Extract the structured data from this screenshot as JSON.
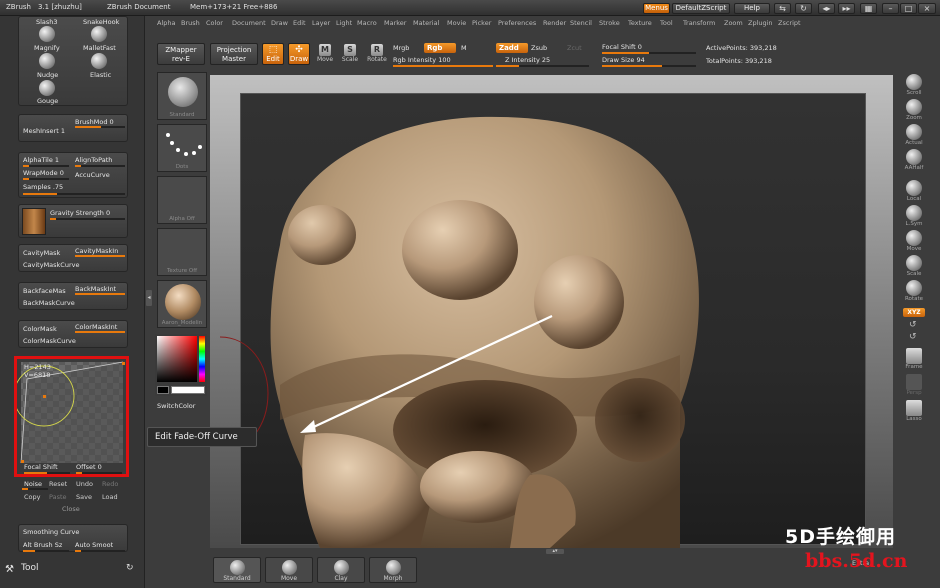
{
  "titlebar": {
    "app": "ZBrush",
    "version": "3.1 [zhuzhu]",
    "document": "ZBrush Document",
    "mem": "Mem+173+21 Free+886",
    "menus": "Menus",
    "script": "DefaultZScript",
    "help": "Help"
  },
  "menubar": {
    "items": [
      "Alpha",
      "Brush",
      "Color",
      "Document",
      "Draw",
      "Edit",
      "Layer",
      "Light",
      "Macro",
      "Marker",
      "Material",
      "Movie",
      "Picker",
      "Preferences",
      "Render",
      "Stencil",
      "Stroke",
      "Texture",
      "Tool",
      "Transform",
      "Zoom",
      "Zplugin",
      "Zscript"
    ]
  },
  "leftpanel": {
    "brushes": [
      "Slash3",
      "SnakeHook",
      "Magnify",
      "MalletFast",
      "Nudge",
      "Elastic",
      "Gouge"
    ],
    "meshinsert": {
      "brushmod": "BrushMod 0",
      "label": "MeshInsert 1"
    },
    "alpha": {
      "alphatile": "AlphaTile 1",
      "aligntopath": "AlignToPath",
      "wrapmode": "WrapMode 0",
      "accucurve": "AccuCurve",
      "samples": "Samples .75"
    },
    "gravity": "Gravity Strength 0",
    "cavity": {
      "mask": "CavityMask",
      "maskint": "CavityMaskIn",
      "curve": "CavityMaskCurve"
    },
    "backface": {
      "mask": "BackfaceMas",
      "maskint": "BackMaskInt",
      "curve": "BackMaskCurve"
    },
    "color": {
      "mask": "ColorMask",
      "maskint": "ColorMaskInt",
      "curve": "ColorMaskCurve"
    },
    "curve": {
      "readout_h": "H=2143",
      "readout_v": "V=6818",
      "focal": "Focal Shift",
      "offset": "Offset 0"
    },
    "curve_buttons": {
      "noise": "Noise",
      "reset": "Reset",
      "undo": "Undo",
      "redo": "Redo",
      "copy": "Copy",
      "paste": "Paste",
      "save": "Save",
      "load": "Load",
      "close": "Close"
    },
    "smoothing": {
      "label": "Smoothing Curve",
      "alt": "Alt Brush Sz",
      "auto": "Auto Smoot"
    },
    "tool": "Tool"
  },
  "shelf": {
    "zmapper": "ZMapper",
    "zmapper_rev": "rev-E",
    "projection": "Projection",
    "master": "Master",
    "edit": "Edit",
    "draw": "Draw",
    "move": "Move",
    "scale": "Scale",
    "rotate": "Rotate",
    "mrgb": "Mrgb",
    "rgb": "Rgb",
    "m": "M",
    "rgb_intensity": "Rgb Intensity 100",
    "zadd": "Zadd",
    "zsub": "Zsub",
    "zcut": "Zcut",
    "z_intensity": "Z Intensity 25",
    "focal_shift": "Focal Shift 0",
    "draw_size": "Draw Size 94",
    "active_points": "ActivePoints: 393,218",
    "total_points": "TotalPoints: 393,218",
    "rgb_intensity_value": 1.0,
    "z_intensity_value": 0.25
  },
  "palette": {
    "standard": "Standard",
    "dots": "Dots",
    "alpha_off": "Alpha  Off",
    "texture_off": "Texture  Off",
    "material": "Aaron_Modelin",
    "switchcolor": "SwitchColor"
  },
  "tooltip": "Edit Fade-Off Curve",
  "righttools": [
    "Scroll",
    "Zoom",
    "Actual",
    "AAHalf",
    "Local",
    "L.Sym",
    "Move",
    "Scale",
    "Rotate",
    "XYZ",
    "Frame",
    "Persp",
    "Lasso"
  ],
  "bottom": {
    "brushes": [
      "Standard",
      "Move",
      "Clay",
      "Morph"
    ],
    "extra": "Extra"
  },
  "watermark": {
    "line1": "5D手绘御用",
    "line2": "bbs.5d.cn"
  },
  "colors": {
    "accent": "#e8790c",
    "highlight_box": "#e01010",
    "watermark_red": "#e4141e"
  }
}
